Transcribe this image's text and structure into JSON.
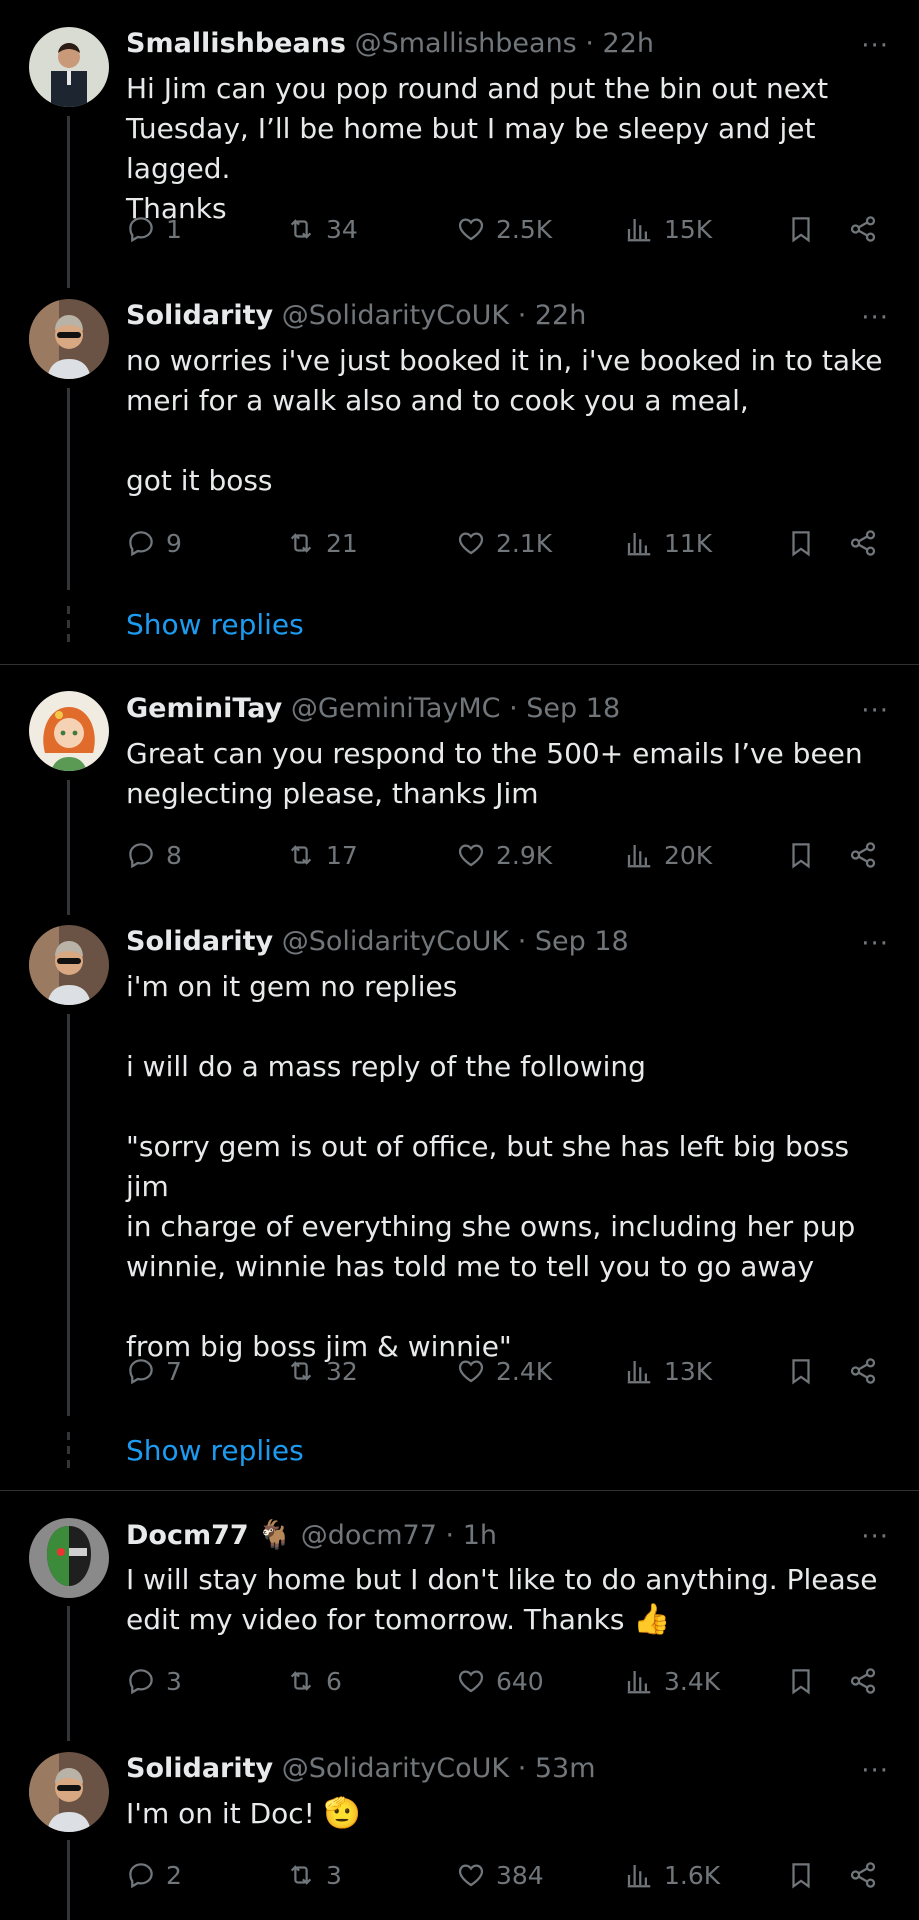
{
  "tweets": [
    {
      "name": "Smallishbeans",
      "handle": "@Smallishbeans",
      "time": "22h",
      "text": "Hi Jim can you pop round and put the bin out next\nTuesday, I’ll be home but I may be sleepy and jet lagged.\nThanks",
      "replies": "1",
      "retweets": "34",
      "likes": "2.5K",
      "views": "15K"
    },
    {
      "name": "Solidarity",
      "handle": "@SolidarityCoUK",
      "time": "22h",
      "text": "no worries i've just booked it in, i've booked in to take\nmeri for a walk also and to cook you a meal,\n\ngot it boss",
      "replies": "9",
      "retweets": "21",
      "likes": "2.1K",
      "views": "11K"
    },
    {
      "name": "GeminiTay",
      "handle": "@GeminiTayMC",
      "time": "Sep 18",
      "text": "Great can you respond to the 500+ emails I’ve been\nneglecting please, thanks Jim",
      "replies": "8",
      "retweets": "17",
      "likes": "2.9K",
      "views": "20K"
    },
    {
      "name": "Solidarity",
      "handle": "@SolidarityCoUK",
      "time": "Sep 18",
      "text": "i'm on it gem no replies\n\ni will do a mass reply of the following\n\n\"sorry gem is out of office, but she has left big boss jim\nin charge of everything she owns, including her pup\nwinnie, winnie has told me to tell you to go away\n\nfrom big boss jim & winnie\"",
      "replies": "7",
      "retweets": "32",
      "likes": "2.4K",
      "views": "13K"
    },
    {
      "name": "Docm77",
      "handle": "@docm77",
      "time": "1h",
      "text": "I will stay home but I don't like to do anything. Please\nedit my video for tomorrow. Thanks ",
      "emoji": "👍",
      "replies": "3",
      "retweets": "6",
      "likes": "640",
      "views": "3.4K"
    },
    {
      "name": "Solidarity",
      "handle": "@SolidarityCoUK",
      "time": "53m",
      "text": "I'm on it Doc! ",
      "emoji": "🫡",
      "replies": "2",
      "retweets": "3",
      "likes": "384",
      "views": "1.6K"
    }
  ],
  "show_replies_label": "Show replies",
  "separator": "·",
  "more_label": "···",
  "goat_badge": "🐐",
  "icons": {
    "reply": "reply-icon",
    "retweet": "retweet-icon",
    "like": "heart-icon",
    "views": "views-icon",
    "bookmark": "bookmark-icon",
    "share": "share-icon"
  },
  "colors": {
    "background": "#000000",
    "text": "#e7e9ea",
    "muted": "#71767b",
    "link": "#1d9bf0"
  }
}
